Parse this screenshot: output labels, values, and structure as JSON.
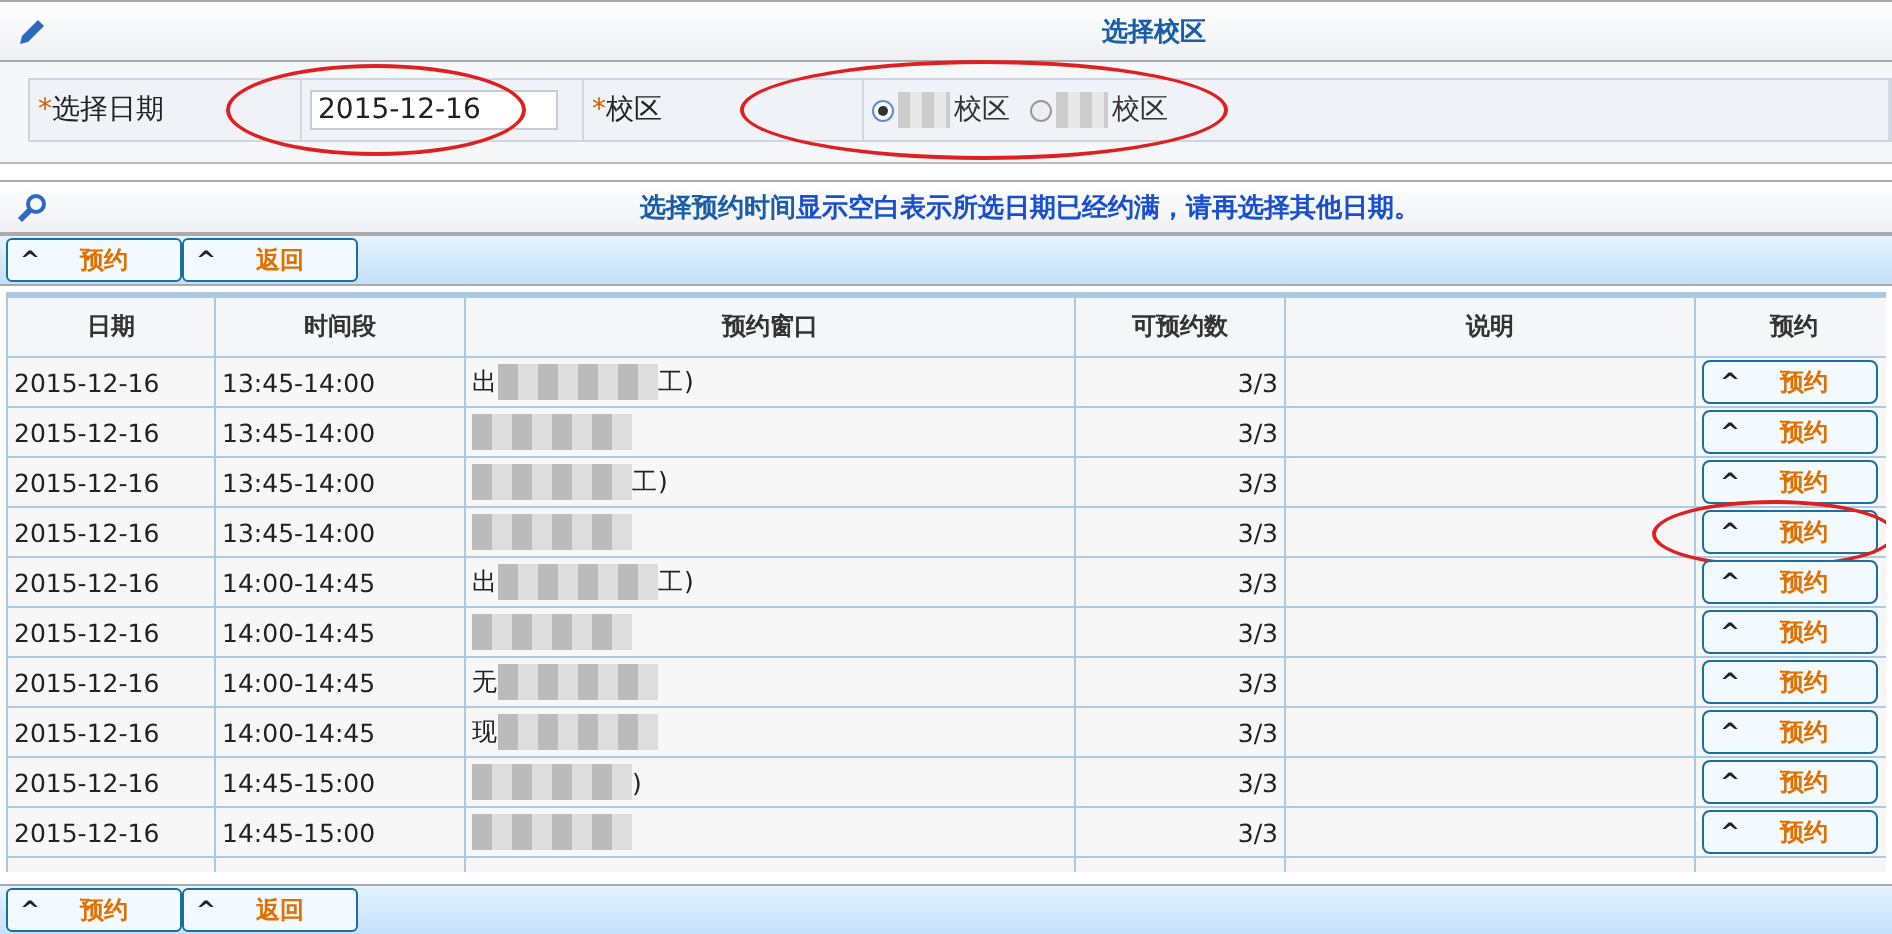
{
  "header": {
    "title": "选择校区"
  },
  "form": {
    "date_label": "选择日期",
    "date_required": "*",
    "date_value": "2015-12-16",
    "date_circled": true,
    "campus_label": "校区",
    "campus_required": "*",
    "campus_circled": true,
    "campus_options": [
      {
        "label": "校区",
        "selected": true
      },
      {
        "label": "校区",
        "selected": false
      }
    ]
  },
  "notice": {
    "lead": "选择预约时间",
    "text": "显示空白表示所选日期已经约满，请再选择其他日期。"
  },
  "toolbar_top": [
    {
      "icon": "^",
      "label": "预约"
    },
    {
      "icon": "^",
      "label": "返回"
    }
  ],
  "table": {
    "columns": [
      "日期",
      "时间段",
      "预约窗口",
      "可预约数",
      "说明",
      "预约"
    ],
    "rows": [
      {
        "date": "2015-12-16",
        "time": "13:45-14:00",
        "window_start": "出",
        "window_end": "工)",
        "available": "3/3",
        "button_icon": "^",
        "button": "预约",
        "circled": false
      },
      {
        "date": "2015-12-16",
        "time": "13:45-14:00",
        "available": "3/3",
        "button_icon": "^",
        "button": "预约",
        "circled": false
      },
      {
        "date": "2015-12-16",
        "time": "13:45-14:00",
        "window_end": "工)",
        "available": "3/3",
        "button_icon": "^",
        "button": "预约",
        "circled": false
      },
      {
        "date": "2015-12-16",
        "time": "13:45-14:00",
        "available": "3/3",
        "button_icon": "^",
        "button": "预约",
        "circled": true
      },
      {
        "date": "2015-12-16",
        "time": "14:00-14:45",
        "window_start": "出",
        "window_end": "工)",
        "available": "3/3",
        "button_icon": "^",
        "button": "预约",
        "circled": false
      },
      {
        "date": "2015-12-16",
        "time": "14:00-14:45",
        "available": "3/3",
        "button_icon": "^",
        "button": "预约",
        "circled": false
      },
      {
        "date": "2015-12-16",
        "time": "14:00-14:45",
        "window_start": "无",
        "available": "3/3",
        "button_icon": "^",
        "button": "预约",
        "circled": false
      },
      {
        "date": "2015-12-16",
        "time": "14:00-14:45",
        "window_start": "现",
        "available": "3/3",
        "button_icon": "^",
        "button": "预约",
        "circled": false
      },
      {
        "date": "2015-12-16",
        "time": "14:45-15:00",
        "window_end": ")",
        "available": "3/3",
        "button_icon": "^",
        "button": "预约",
        "circled": false
      },
      {
        "date": "2015-12-16",
        "time": "14:45-15:00",
        "available": "3/3",
        "button_icon": "^",
        "button": "预约",
        "circled": false
      }
    ]
  },
  "toolbar_bottom": [
    {
      "icon": "^",
      "label": "预约"
    },
    {
      "icon": "^",
      "label": "返回"
    }
  ]
}
